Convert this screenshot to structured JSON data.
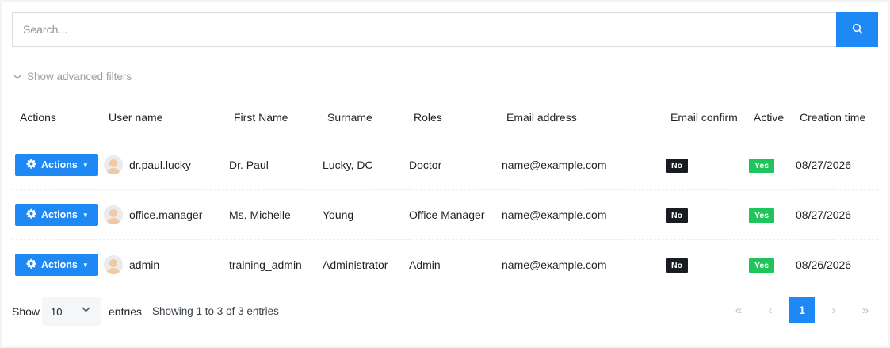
{
  "search": {
    "placeholder": "Search..."
  },
  "filters": {
    "toggle_label": "Show advanced filters"
  },
  "table": {
    "headers": {
      "actions": "Actions",
      "user_name": "User name",
      "first_name": "First Name",
      "surname": "Surname",
      "roles": "Roles",
      "email": "Email address",
      "email_confirm": "Email confirm",
      "active": "Active",
      "creation_time": "Creation time"
    },
    "rows": [
      {
        "action_label": "Actions",
        "user_name": "dr.paul.lucky",
        "first_name": "Dr. Paul",
        "surname": "Lucky, DC",
        "roles": "Doctor",
        "email": "name@example.com",
        "email_confirm": "No",
        "active": "Yes",
        "creation_time": "08/27/2026"
      },
      {
        "action_label": "Actions",
        "user_name": "office.manager",
        "first_name": "Ms. Michelle",
        "surname": "Young",
        "roles": "Office Manager",
        "email": "name@example.com",
        "email_confirm": "No",
        "active": "Yes",
        "creation_time": "08/27/2026"
      },
      {
        "action_label": "Actions",
        "user_name": "admin",
        "first_name": "training_admin",
        "surname": "Administrator",
        "roles": "Admin",
        "email": "name@example.com",
        "email_confirm": "No",
        "active": "Yes",
        "creation_time": "08/26/2026"
      }
    ]
  },
  "footer": {
    "show_label": "Show",
    "page_length": "10",
    "entries_label": "entries",
    "info": "Showing 1 to 3 of 3 entries",
    "pager": {
      "first": "«",
      "prev": "‹",
      "current": "1",
      "next": "›",
      "last": "»"
    }
  },
  "colors": {
    "accent": "#1e88f5",
    "badge_no": "#181c21",
    "badge_yes": "#1fc45a"
  },
  "icons": {
    "search": "search-icon",
    "filter_toggle": "chevron-down-icon",
    "action": "cog-icon",
    "avatar": "user-avatar-icon"
  }
}
